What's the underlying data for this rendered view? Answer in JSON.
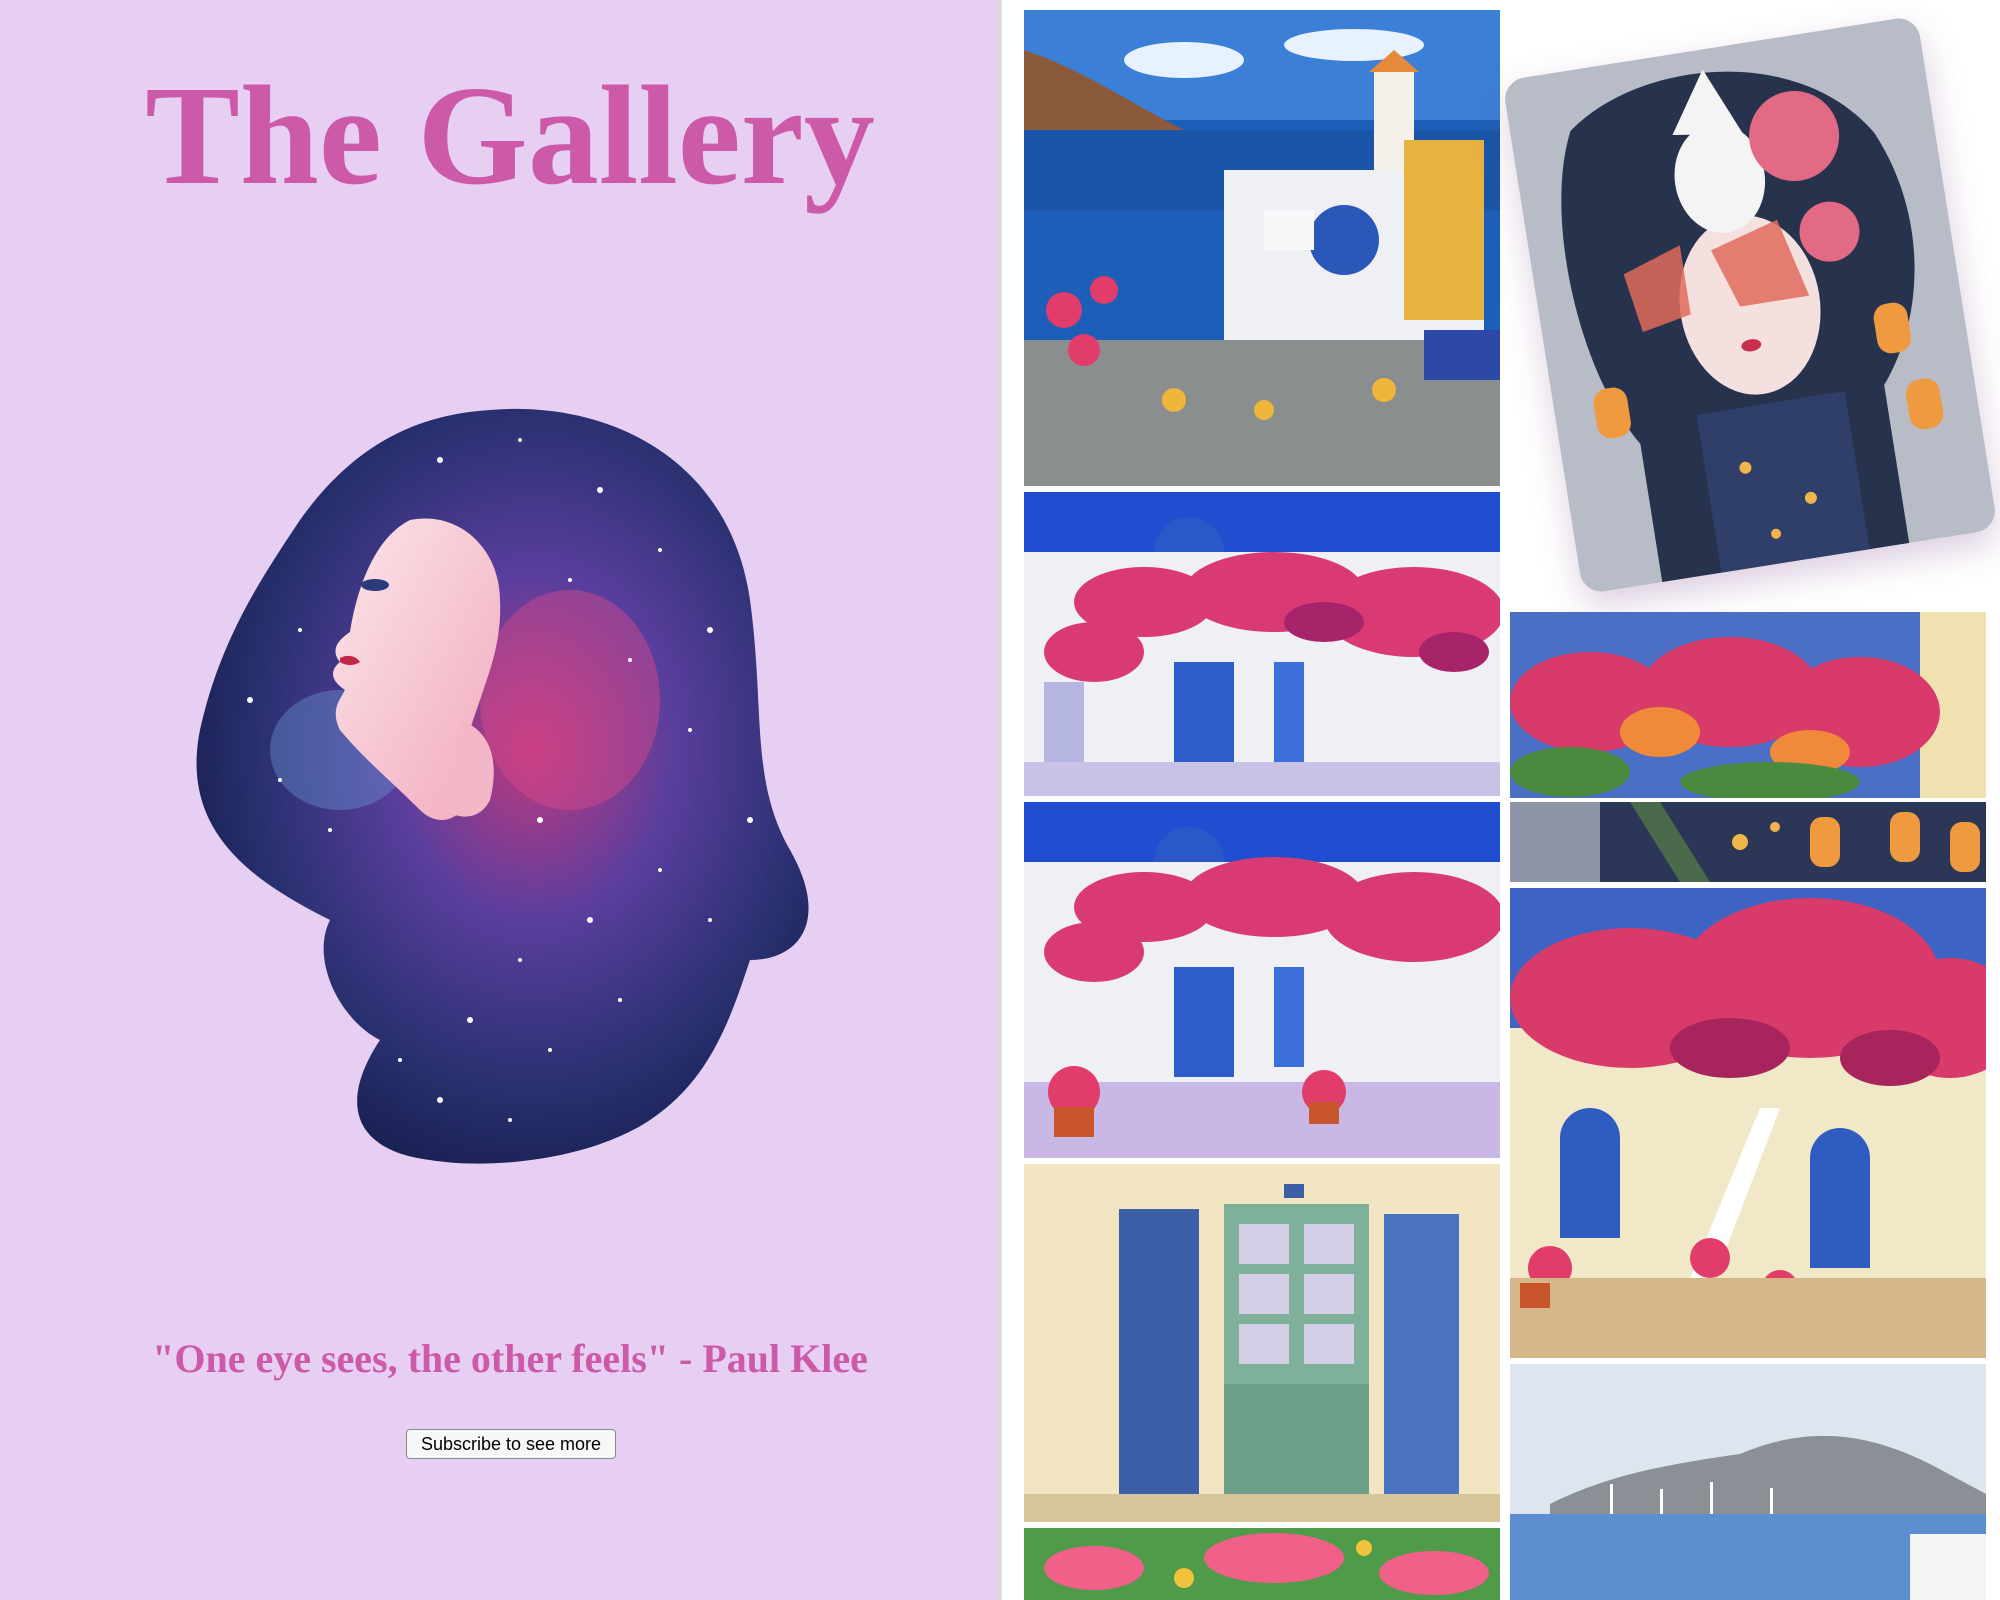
{
  "hero_panel": {
    "title": "The Gallery",
    "quote": "\"One eye sees, the other feels\"  - Paul Klee",
    "subscribe_label": "Subscribe to see more"
  },
  "artworks": [
    {
      "subject": "Greek seaside village with white houses and blue dome",
      "icon": "landscape-painting"
    },
    {
      "subject": "Bougainvillea over white house with blue door",
      "icon": "house-painting"
    },
    {
      "subject": "Bougainvillea over white house with blue door and flower pots",
      "icon": "house-painting"
    },
    {
      "subject": "Old green door with blue shutters",
      "icon": "door-painting"
    },
    {
      "subject": "Pink flowers close-up",
      "icon": "flower-painting"
    },
    {
      "subject": "Girl with rabbit mask, peonies and lanterns",
      "icon": "portrait-painting"
    },
    {
      "subject": "Bougainvillea bushes",
      "icon": "flower-painting"
    },
    {
      "subject": "Lanterns and stars pattern detail",
      "icon": "pattern-painting"
    },
    {
      "subject": "Courtyard with bougainvillea, arched blue doors and stairs",
      "icon": "courtyard-painting"
    },
    {
      "subject": "Watercolor sea with mountains and sailboats",
      "icon": "seascape-painting"
    }
  ],
  "colors": {
    "panel_background": "#e6cff3",
    "accent_text": "#cd5aa8"
  }
}
